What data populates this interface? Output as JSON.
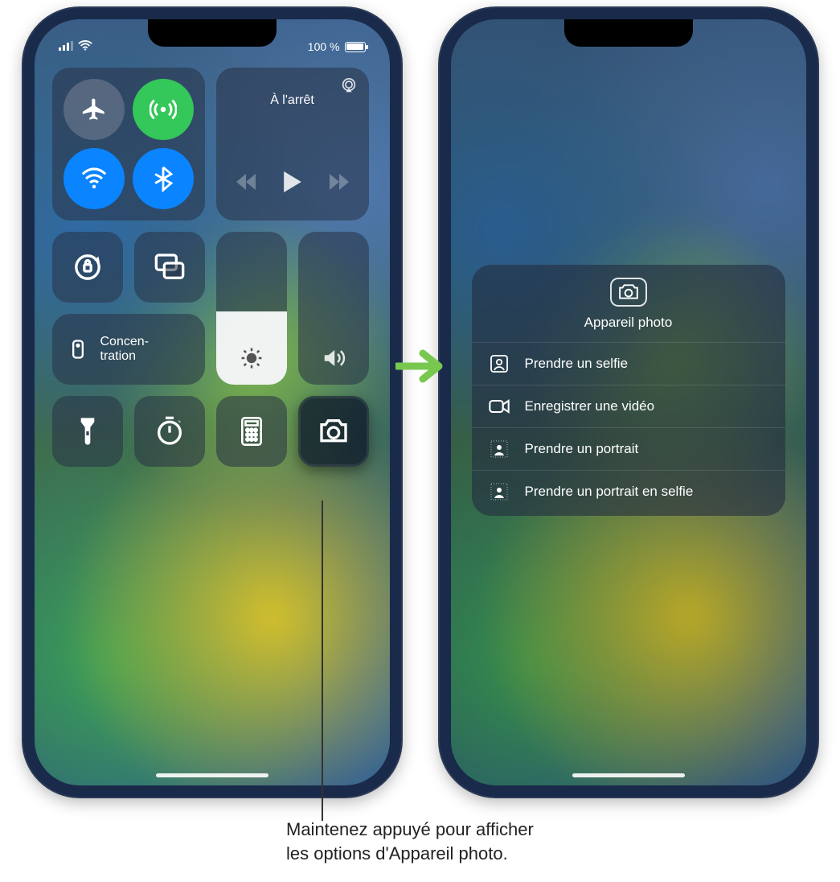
{
  "status": {
    "battery_pct": "100 %"
  },
  "media": {
    "status_label": "À l'arrêt"
  },
  "focus": {
    "label": "Concen-\ntration"
  },
  "camera_popup": {
    "title": "Appareil photo",
    "options": [
      "Prendre un selfie",
      "Enregistrer une vidéo",
      "Prendre un portrait",
      "Prendre un portrait en selfie"
    ]
  },
  "callout": {
    "line1": "Maintenez appuyé pour afficher",
    "line2": "les options d'Appareil photo."
  }
}
